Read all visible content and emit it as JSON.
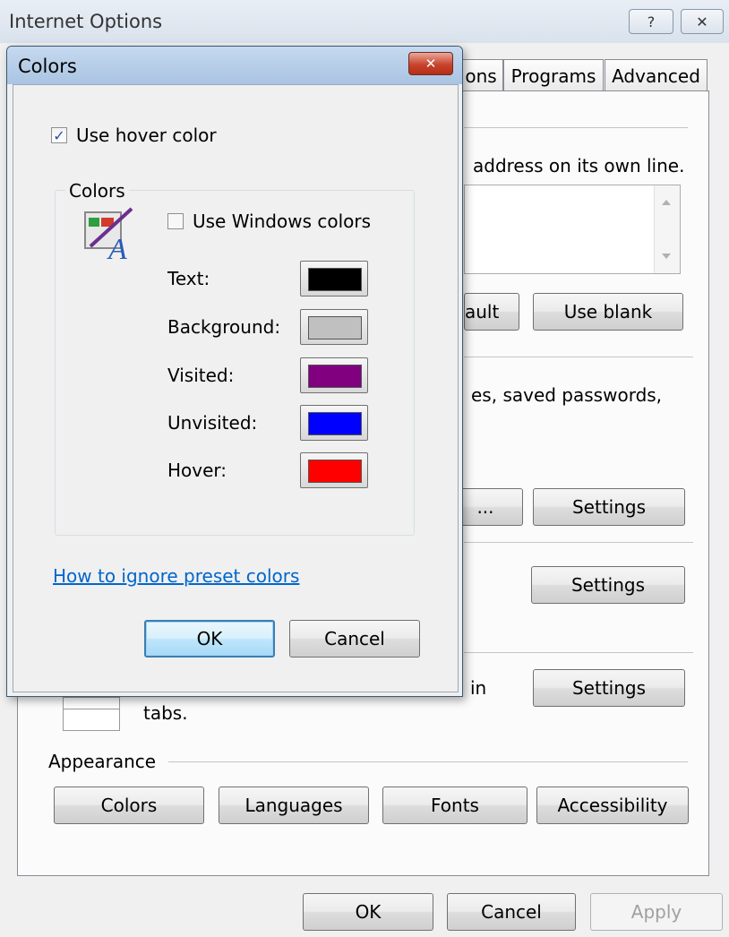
{
  "window": {
    "title": "Internet Options",
    "help_glyph": "?",
    "close_glyph": "✕"
  },
  "tabs": [
    {
      "label": "ons"
    },
    {
      "label": "Programs"
    },
    {
      "label": "Advanced"
    }
  ],
  "background": {
    "home_text": "address on its own line.",
    "use_default_partial": "ault",
    "use_blank": "Use blank",
    "history_text": "es, saved passwords,",
    "delete_partial": "...",
    "settings_label": "Settings",
    "tabs_text_in": "in",
    "tabs_text_tabs": "tabs.",
    "appearance_heading": "Appearance",
    "appearance_buttons": [
      "Colors",
      "Languages",
      "Fonts",
      "Accessibility"
    ],
    "ok": "OK",
    "cancel": "Cancel",
    "apply": "Apply"
  },
  "dialog": {
    "title": "Colors",
    "use_hover_label": "Use hover color",
    "use_hover_checked": true,
    "group_label": "Colors",
    "use_windows_label": "Use Windows colors",
    "use_windows_checked": false,
    "rows": [
      {
        "label": "Text:",
        "color": "#000000"
      },
      {
        "label": "Background:",
        "color": "#c0c0c0"
      },
      {
        "label": "Visited:",
        "color": "#800080"
      },
      {
        "label": "Unvisited:",
        "color": "#0000ff"
      },
      {
        "label": "Hover:",
        "color": "#ff0000"
      }
    ],
    "link_text": "How to ignore preset colors",
    "ok": "OK",
    "cancel": "Cancel",
    "check_glyph": "✓"
  }
}
